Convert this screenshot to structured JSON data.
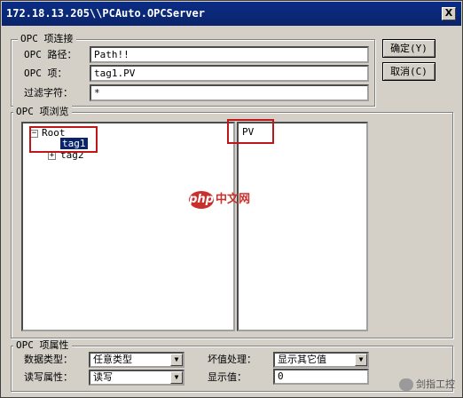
{
  "window": {
    "title": "172.18.13.205\\\\PCAuto.OPCServer",
    "close_label": "X"
  },
  "connect": {
    "legend": "OPC 项连接",
    "path_label": "OPC 路径：",
    "path_value": "Path!!",
    "item_label": "OPC 项：",
    "item_value": "tag1.PV",
    "filter_label": "过滤字符：",
    "filter_value": "*"
  },
  "buttons": {
    "ok": "确定(Y)",
    "cancel": "取消(C)"
  },
  "browse": {
    "legend": "OPC 项浏览",
    "tree": [
      {
        "label": "Root",
        "expander": "−"
      },
      {
        "label": "tag1"
      },
      {
        "label": "tag2",
        "expander": "+"
      }
    ],
    "properties": [
      "PV"
    ]
  },
  "attributes": {
    "legend": "OPC 项属性",
    "data_type_label": "数据类型：",
    "data_type_value": "任意类型",
    "access_label": "读写属性：",
    "access_value": "读写",
    "bad_value_label": "坏值处理：",
    "bad_value_value": "显示其它值",
    "display_label": "显示值：",
    "display_value": "0"
  },
  "watermark": {
    "logo": "php",
    "text": "中文网"
  },
  "brand": {
    "text": "剑指工控"
  },
  "colors": {
    "title_bar": "#0a246a",
    "highlight_box": "#c0161a",
    "dialog_bg": "#d4d0c8"
  }
}
